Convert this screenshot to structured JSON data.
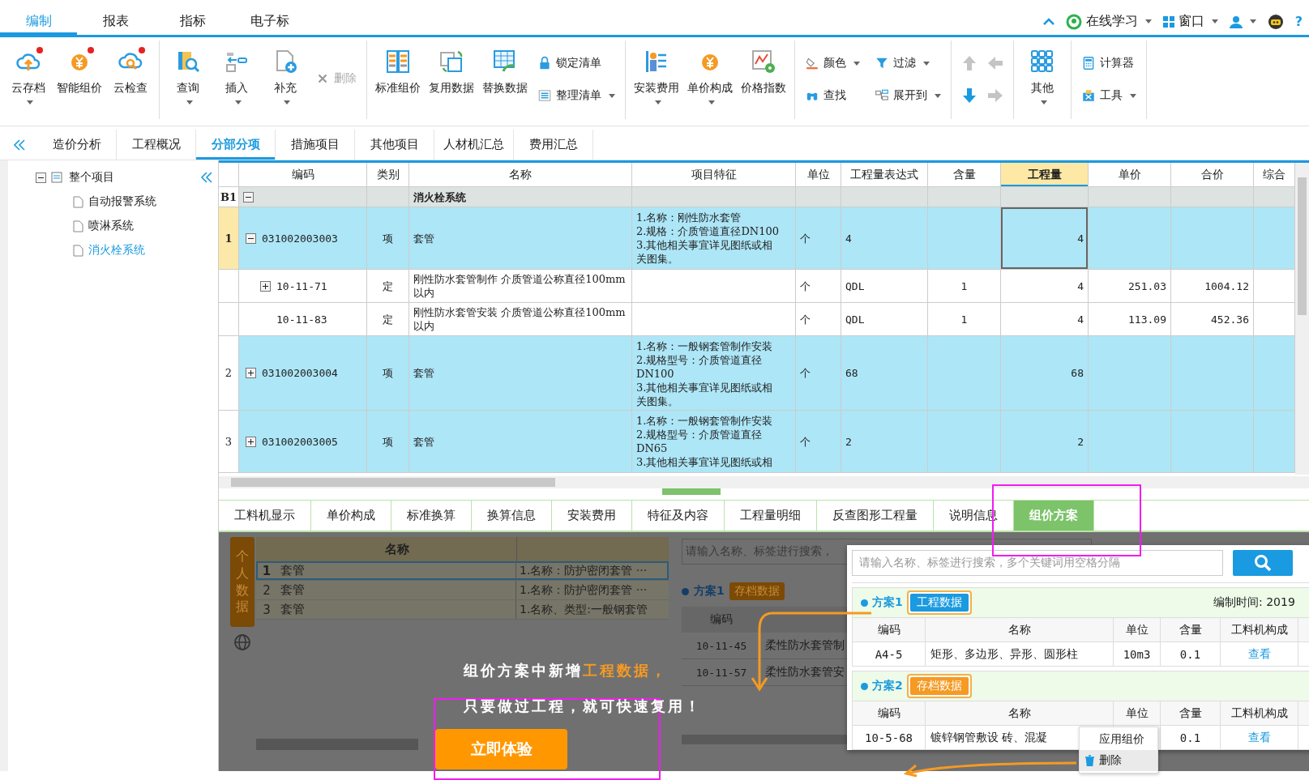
{
  "menu_tabs": [
    {
      "label": "编制",
      "selected": true
    },
    {
      "label": "报表",
      "selected": false
    },
    {
      "label": "指标",
      "selected": false
    },
    {
      "label": "电子标",
      "selected": false
    }
  ],
  "top_right": [
    {
      "label": "在线学习",
      "dropdown": true
    },
    {
      "label": "窗口",
      "dropdown": true
    }
  ],
  "help": "?",
  "toolbar": [
    [
      {
        "kind": "large",
        "label": "云存档",
        "dropdown": true,
        "badge": true
      },
      {
        "kind": "large",
        "label": "智能组价",
        "dropdown": false,
        "badge": true
      },
      {
        "kind": "large",
        "label": "云检查",
        "dropdown": false,
        "badge": true
      }
    ],
    [
      {
        "kind": "large",
        "label": "查询",
        "dropdown": true,
        "badge": false
      },
      {
        "kind": "large",
        "label": "插入",
        "dropdown": true,
        "badge": false
      },
      {
        "kind": "large",
        "label": "补充",
        "dropdown": true,
        "badge": false
      },
      {
        "kind": "small",
        "label": "删除",
        "dropdown": false,
        "disabled": true
      }
    ],
    [
      {
        "kind": "large",
        "label": "标准组价",
        "dropdown": false,
        "badge": false
      },
      {
        "kind": "large",
        "label": "复用数据",
        "dropdown": false,
        "badge": false
      },
      {
        "kind": "large",
        "label": "替换数据",
        "dropdown": false,
        "badge": false
      },
      {
        "kind": "small",
        "label": "锁定清单",
        "dropdown": false,
        "disabled": false
      },
      {
        "kind": "small",
        "label": "整理清单",
        "dropdown": true,
        "disabled": false
      }
    ],
    [
      {
        "kind": "large",
        "label": "安装费用",
        "dropdown": true,
        "badge": false
      },
      {
        "kind": "large",
        "label": "单价构成",
        "dropdown": true,
        "badge": false
      },
      {
        "kind": "large",
        "label": "价格指数",
        "dropdown": false,
        "badge": false
      }
    ],
    [
      {
        "kind": "small",
        "label": "颜色",
        "dropdown": true,
        "disabled": false
      },
      {
        "kind": "small",
        "label": "查找",
        "dropdown": false,
        "disabled": false
      },
      {
        "kind": "small",
        "label": "过滤",
        "dropdown": true,
        "disabled": false
      },
      {
        "kind": "small",
        "label": "展开到",
        "dropdown": true,
        "disabled": false
      }
    ],
    [
      {
        "kind": "arrow",
        "disabled": true
      },
      {
        "kind": "arrow",
        "disabled": true
      },
      {
        "kind": "arrow",
        "disabled": false
      },
      {
        "kind": "arrow",
        "disabled": true
      }
    ],
    [
      {
        "kind": "large",
        "label": "其他",
        "dropdown": true,
        "badge": false
      }
    ],
    [
      {
        "kind": "small",
        "label": "计算器",
        "dropdown": false,
        "disabled": false
      },
      {
        "kind": "small",
        "label": "工具",
        "dropdown": true,
        "disabled": false
      }
    ]
  ],
  "page_tabs": [
    {
      "label": "造价分析",
      "selected": false
    },
    {
      "label": "工程概况",
      "selected": false
    },
    {
      "label": "分部分项",
      "selected": true
    },
    {
      "label": "措施项目",
      "selected": false
    },
    {
      "label": "其他项目",
      "selected": false
    },
    {
      "label": "人材机汇总",
      "selected": false
    },
    {
      "label": "费用汇总",
      "selected": false
    }
  ],
  "tree": {
    "label": "整个项目",
    "expanded": true,
    "children": [
      {
        "label": "自动报警系统",
        "selected": false
      },
      {
        "label": "喷淋系统",
        "selected": false
      },
      {
        "label": "消火栓系统",
        "selected": true
      }
    ]
  },
  "table": {
    "columns": [
      {
        "label": "编码",
        "selected": false
      },
      {
        "label": "类别",
        "selected": false
      },
      {
        "label": "名称",
        "selected": false
      },
      {
        "label": "项目特征",
        "selected": false
      },
      {
        "label": "单位",
        "selected": false
      },
      {
        "label": "工程量表达式",
        "selected": false
      },
      {
        "label": "含量",
        "selected": false
      },
      {
        "label": "工程量",
        "selected": true
      },
      {
        "label": "单价",
        "selected": false
      },
      {
        "label": "合价",
        "selected": false
      },
      {
        "label": "综合",
        "selected": false
      }
    ],
    "section": {
      "no": "B1",
      "expanded": true,
      "name": "消火栓系统"
    },
    "rows": [
      {
        "kind": "item",
        "no": "1",
        "selected": true,
        "expanded": true,
        "code": "031002003003",
        "type": "项",
        "name": "套管",
        "features": [
          "1.名称：刚性防水套管",
          "2.规格：介质管道直径DN100",
          "3.其他相关事宜详见图纸或相",
          "关图集。"
        ],
        "unit": "个",
        "expr": "4",
        "qty": "4",
        "children": [
          {
            "kind": "quota",
            "selected": false,
            "expanded": false,
            "code": "10-11-71",
            "type": "定",
            "name": "刚性防水套管制作 介质管道公称直径100mm以内",
            "unit": "个",
            "expr": "QDL",
            "content": "1",
            "qty": "4",
            "price": "251.03",
            "total": "1004.12"
          },
          {
            "kind": "quota",
            "selected": false,
            "code": "10-11-83",
            "type": "定",
            "name": "刚性防水套管安装 介质管道公称直径100mm以内",
            "unit": "个",
            "expr": "QDL",
            "content": "1",
            "qty": "4",
            "price": "113.09",
            "total": "452.36"
          }
        ]
      },
      {
        "kind": "item",
        "no": "2",
        "selected": false,
        "expanded": false,
        "code": "031002003004",
        "type": "项",
        "name": "套管",
        "features": [
          "1.名称：一般钢套管制作安装",
          "2.规格型号：介质管道直径",
          "DN100",
          "3.其他相关事宜详见图纸或相",
          "关图集。"
        ],
        "unit": "个",
        "expr": "68",
        "qty": "68"
      },
      {
        "kind": "item",
        "no": "3",
        "selected": false,
        "expanded": false,
        "code": "031002003005",
        "type": "项",
        "name": "套管",
        "features": [
          "1.名称：一般钢套管制作安装",
          "2.规格型号：介质管道直径",
          "DN65",
          "3.其他相关事宜详见图纸或相"
        ],
        "unit": "个",
        "expr": "2",
        "qty": "2"
      }
    ]
  },
  "bottom_tabs": [
    {
      "label": "工料机显示",
      "selected": false
    },
    {
      "label": "单价构成",
      "selected": false
    },
    {
      "label": "标准换算",
      "selected": false
    },
    {
      "label": "换算信息",
      "selected": false
    },
    {
      "label": "安装费用",
      "selected": false
    },
    {
      "label": "特征及内容",
      "selected": false
    },
    {
      "label": "工程量明细",
      "selected": false
    },
    {
      "label": "反查图形工程量",
      "selected": false
    },
    {
      "label": "说明信息",
      "selected": false
    },
    {
      "label": "组价方案",
      "selected": true
    }
  ],
  "personal_panel": {
    "tab": "个人数据",
    "column": "名称",
    "rows": [
      {
        "no": "1",
        "name": "套管",
        "feature": "1.名称：防护密闭套管 ···",
        "selected": true
      },
      {
        "no": "2",
        "name": "套管",
        "feature": "1.名称：防护密闭套管 ···",
        "selected": false
      },
      {
        "no": "3",
        "name": "套管",
        "feature": "1.名称、类型:一般钢套管",
        "selected": false
      }
    ],
    "scroll": true
  },
  "plans_panel": {
    "placeholder": "请输入名称、标签进行搜索，",
    "plan": "方案1",
    "tag": "存档数据",
    "column": "编码",
    "rows": [
      {
        "code": "10-11-45",
        "name": "柔性防水套管制"
      },
      {
        "code": "10-11-57",
        "name": "柔性防水套管安"
      }
    ]
  },
  "popup": {
    "placeholder": "请输入名称、标签进行搜索，多个关键词用空格分隔",
    "plans": [
      {
        "title": "方案1",
        "tag": "工程数据",
        "kind": "project",
        "date": "编制时间: 2019",
        "columns": [
          "编码",
          "名称",
          "单位",
          "含量",
          "工料机构成"
        ],
        "rows": [
          {
            "code": "A4-5",
            "name": "矩形、多边形、异形、圆形柱",
            "unit": "10m3",
            "content": "0.1",
            "link": "查看"
          }
        ]
      },
      {
        "title": "方案2",
        "tag": "存档数据",
        "kind": "archive",
        "columns": [
          "编码",
          "名称",
          "单位",
          "含量",
          "工料机构成"
        ],
        "rows": [
          {
            "code": "10-5-68",
            "name": "镀锌钢管敷设 砖、混凝",
            "content": "0.1",
            "link": "查看"
          }
        ]
      }
    ],
    "context_menu": [
      {
        "label": "应用组价",
        "icon": false
      },
      {
        "label": "删除",
        "icon": true
      }
    ]
  },
  "promo": {
    "lines": [
      [
        {
          "text": "组价方案中新增",
          "highlight": false
        },
        {
          "text": "工程数据，",
          "highlight": true
        }
      ],
      [
        {
          "text": "只要做过工程，就可快速复用！",
          "highlight": false
        }
      ]
    ],
    "button": "立即体验"
  }
}
